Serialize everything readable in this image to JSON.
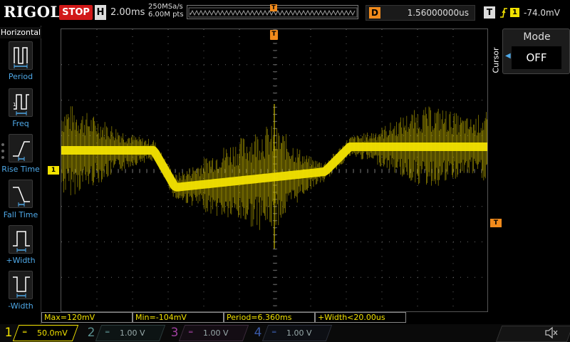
{
  "top": {
    "brand": "RIGOL",
    "run_state": "STOP",
    "timebase_prefix": "H",
    "timebase": "2.00ms",
    "sample_rate": "250MSa/s",
    "memory_depth": "6.00M pts",
    "trigger_pos_marker": "T",
    "delay_prefix": "D",
    "delay": "1.56000000us",
    "trigger_prefix": "T",
    "trigger_edge_icon": "rising-edge-icon",
    "trigger_source": "1",
    "trigger_level": "-74.0mV"
  },
  "left_menu": {
    "title": "Horizontal",
    "items": [
      {
        "label": "Period",
        "icon": "period-icon"
      },
      {
        "label": "Freq",
        "icon": "freq-icon"
      },
      {
        "label": "Rise Time",
        "icon": "rise-time-icon"
      },
      {
        "label": "Fall Time",
        "icon": "fall-time-icon"
      },
      {
        "label": "+Width",
        "icon": "pos-width-icon"
      },
      {
        "label": "-Width",
        "icon": "neg-width-icon"
      }
    ]
  },
  "markers": {
    "trigger_position": "T",
    "channel1": "1",
    "trigger_level": "T"
  },
  "right_menu": {
    "side_title": "Cursor",
    "mode_label": "Mode",
    "mode_value": "OFF"
  },
  "measurements": [
    "Max=120mV",
    "Min=-104mV",
    "Period=6.360ms",
    "+Width<20.00us"
  ],
  "channels": [
    {
      "num": "1",
      "scale": "50.0mV",
      "color": "#f2e200",
      "active": true
    },
    {
      "num": "2",
      "scale": "1.00 V",
      "color": "#00c8c8",
      "active": false
    },
    {
      "num": "3",
      "scale": "1.00 V",
      "color": "#d040d0",
      "active": false
    },
    {
      "num": "4",
      "scale": "1.00 V",
      "color": "#3070ff",
      "active": false
    }
  ],
  "colors": {
    "trace": "#f2e200",
    "accent": "#f08a1c",
    "menu_label": "#4fa9e8",
    "stop": "#d11818"
  },
  "speaker_icon": "speaker-mute-icon"
}
